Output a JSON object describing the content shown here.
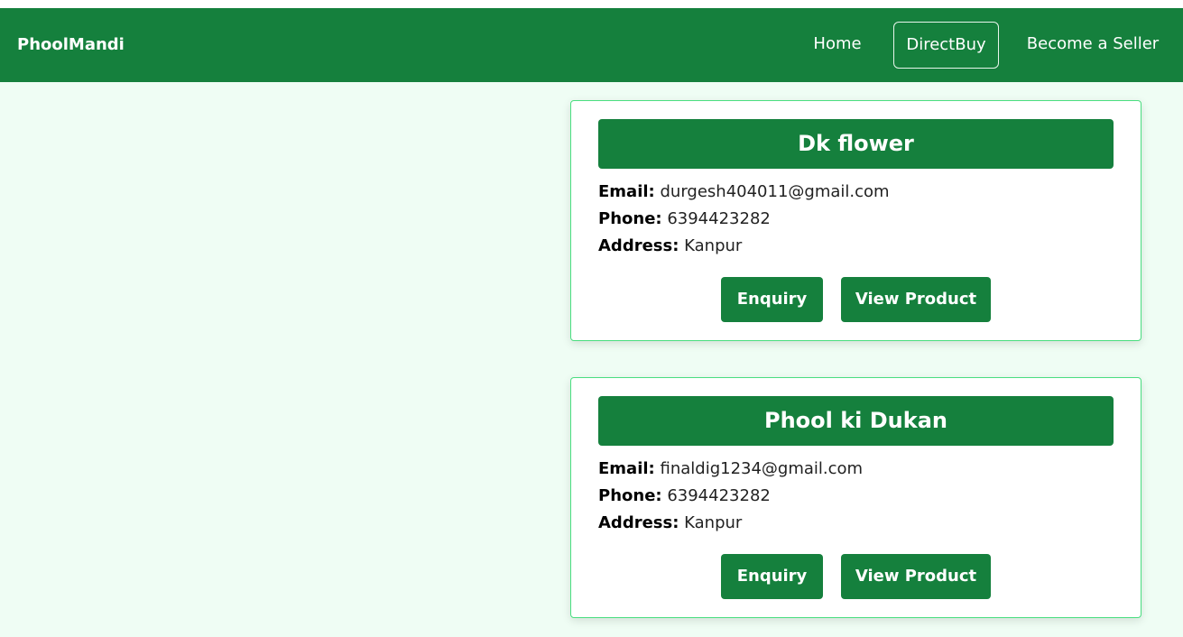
{
  "navbar": {
    "brand": "PhoolMandi",
    "links": {
      "home": "Home",
      "direct_buy": "DirectBuy",
      "become_seller": "Become a Seller"
    }
  },
  "labels": {
    "email": "Email:",
    "phone": "Phone:",
    "address": "Address:"
  },
  "sellers": [
    {
      "name": "Dk flower",
      "email": "durgesh404011@gmail.com",
      "phone": "6394423282",
      "address": "Kanpur",
      "enquiry_label": "Enquiry",
      "view_label": "View Product"
    },
    {
      "name": "Phool ki Dukan",
      "email": "finaldig1234@gmail.com",
      "phone": "6394423282",
      "address": "Kanpur",
      "enquiry_label": "Enquiry",
      "view_label": "View Product"
    }
  ],
  "colors": {
    "primary": "#15803d",
    "background": "#effdf4",
    "card_border": "#4ade80"
  }
}
